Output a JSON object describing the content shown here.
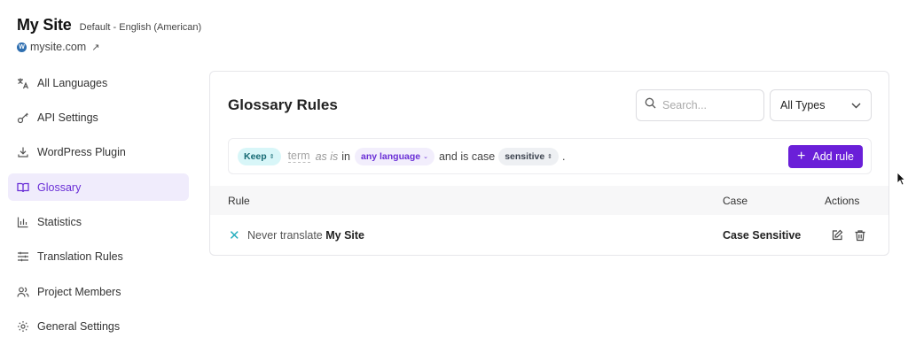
{
  "site": {
    "title": "My Site",
    "language": "Default - English (American)",
    "domain": "mysite.com"
  },
  "sidebar": {
    "items": [
      {
        "label": "All Languages"
      },
      {
        "label": "API Settings"
      },
      {
        "label": "WordPress Plugin"
      },
      {
        "label": "Glossary"
      },
      {
        "label": "Statistics"
      },
      {
        "label": "Translation Rules"
      },
      {
        "label": "Project Members"
      },
      {
        "label": "General Settings"
      }
    ],
    "active": "Glossary"
  },
  "glossary": {
    "title": "Glossary Rules",
    "search_placeholder": "Search...",
    "type_filter": "All Types",
    "builder": {
      "action": "Keep",
      "term_placeholder": "term",
      "as_is": "as is",
      "in_text": "in",
      "language": "any language",
      "case_text": "and is case",
      "case_value": "sensitive",
      "period": "."
    },
    "add_rule_label": "Add rule",
    "table": {
      "headers": {
        "rule": "Rule",
        "case": "Case",
        "actions": "Actions"
      },
      "rows": [
        {
          "prefix": "Never translate",
          "term": "My Site",
          "case": "Case Sensitive"
        }
      ]
    }
  },
  "colors": {
    "accent": "#6a1fd8",
    "active_bg": "#f0ecfc",
    "keep_chip_bg": "#d8f6f8",
    "rule_icon": "#27aebe"
  }
}
